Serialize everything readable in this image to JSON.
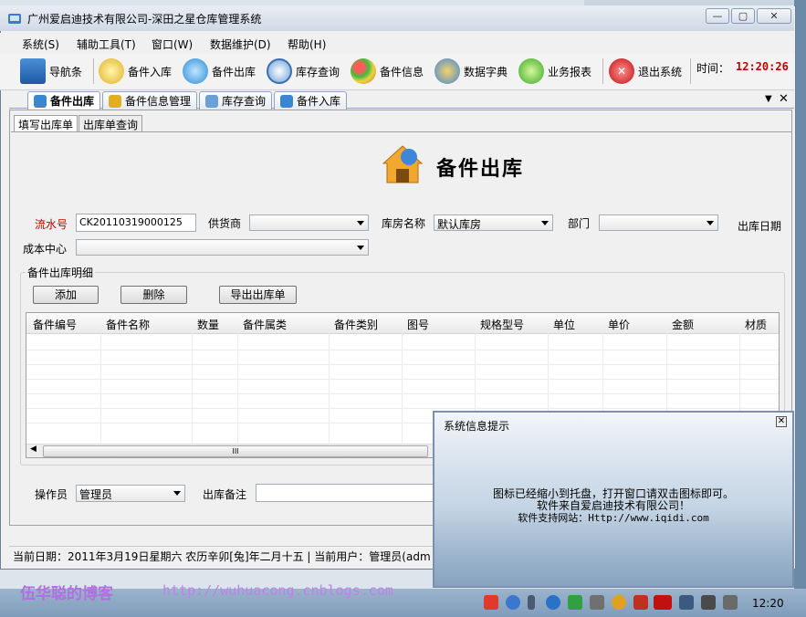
{
  "window": {
    "title": "广州爱启迪技术有限公司-深田之星仓库管理系统"
  },
  "menu": [
    "系统(S)",
    "辅助工具(T)",
    "窗口(W)",
    "数据维护(D)",
    "帮助(H)"
  ],
  "toolbar": {
    "nav": "导航条",
    "in": "备件入库",
    "out": "备件出库",
    "stock": "库存查询",
    "info": "备件信息",
    "dict": "数据字典",
    "report": "业务报表",
    "exit": "退出系统",
    "time_label": "时间：",
    "time": "12:20:26"
  },
  "doc_tabs": [
    "备件出库",
    "备件信息管理",
    "库存查询",
    "备件入库"
  ],
  "sub_tabs": [
    "填写出库单",
    "出库单查询"
  ],
  "page_title": "备件出库",
  "form": {
    "serial_label": "流水号",
    "serial_value": "CK20110319000125",
    "supplier_label": "供货商",
    "supplier_value": "",
    "warehouse_label": "库房名称",
    "warehouse_value": "默认库房",
    "dept_label": "部门",
    "dept_value": "",
    "date_label": "出库日期",
    "cost_center_label": "成本中心",
    "cost_center_value": "",
    "detail_group": "备件出库明细",
    "add_btn": "添加",
    "delete_btn": "删除",
    "export_btn": "导出出库单",
    "operator_label": "操作员",
    "operator_value": "管理员",
    "remark_label": "出库备注",
    "remark_value": ""
  },
  "grid": {
    "columns": [
      "备件编号",
      "备件名称",
      "数量",
      "备件属类",
      "备件类别",
      "图号",
      "规格型号",
      "单位",
      "单价",
      "金额",
      "材质"
    ],
    "scroll_grip": "III"
  },
  "status": {
    "text": "当前日期：2011年3月19日星期六 农历辛卯[兔]年二月十五  |  当前用户：管理员(adm"
  },
  "popup": {
    "title": "系统信息提示",
    "lines": [
      "图标已经缩小到托盘，打开窗口请双击图标即可。",
      "软件来自爱启迪技术有限公司！",
      "软件支持网站：Http://www.iqidi.com"
    ]
  },
  "watermark": {
    "name": "伍华聪的博客",
    "url": "http://wuhuacong.cnblogs.com"
  },
  "taskbar": {
    "clock": "12:20"
  },
  "colors": {
    "time": "#c00000",
    "serial_label": "#c00000",
    "accent": "#8ea4c0"
  }
}
